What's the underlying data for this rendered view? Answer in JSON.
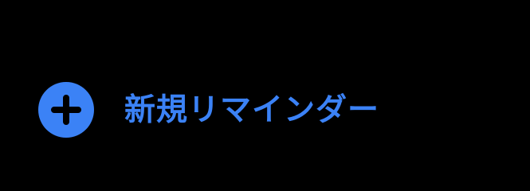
{
  "theme": {
    "background": "#000000",
    "accent": "#3B82F6",
    "icon_plus_color": "#000000"
  },
  "new_reminder": {
    "icon": "plus-circle-icon",
    "label": "新規リマインダー"
  }
}
